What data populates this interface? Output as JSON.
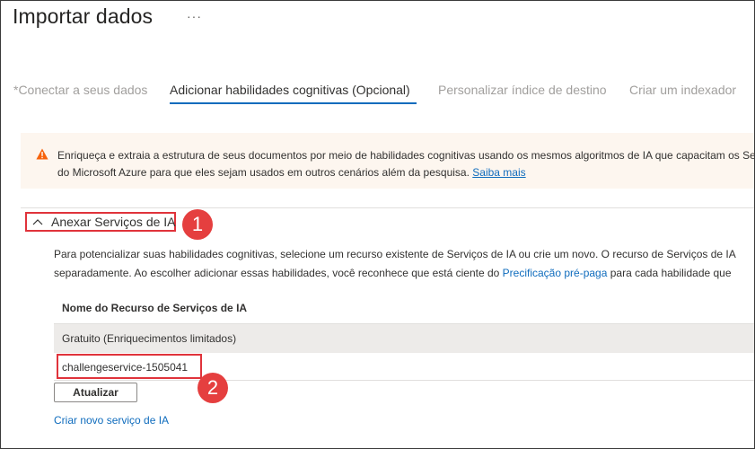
{
  "page": {
    "title": "Importar dados",
    "more_label": "···"
  },
  "tabs": [
    {
      "label": "*Conectar a seus dados",
      "state": "inactive"
    },
    {
      "label": "Adicionar habilidades cognitivas (Opcional)",
      "state": "active"
    },
    {
      "label": "Personalizar índice de destino",
      "state": "inactive"
    },
    {
      "label": "Criar um indexador",
      "state": "inactive"
    }
  ],
  "banner": {
    "icon": "warning-icon",
    "line1": "Enriqueça e extraia a estrutura de seus documentos por meio de habilidades cognitivas usando os mesmos algoritmos de IA que capacitam os Serviços",
    "line2": "do Microsoft Azure para que eles sejam usados em outros cenários além da pesquisa.",
    "link": "Saiba mais"
  },
  "section": {
    "title": "Anexar Serviços de IA",
    "expanded": true,
    "description_line1": "Para potencializar suas habilidades cognitivas, selecione um recurso existente de Serviços de IA ou crie um novo. O recurso de Serviços de IA",
    "description_line2_before": "separadamente. Ao escolher adicionar essas habilidades, você reconhece que está ciente do ",
    "description_link": "Precificação pré-paga",
    "description_line2_after": " para cada habilidade que"
  },
  "table": {
    "header": "Nome do Recurso de Serviços de IA",
    "rows": [
      {
        "name": "Gratuito (Enriquecimentos limitados)",
        "selected": true
      },
      {
        "name": "challengeservice-1505041",
        "selected": false
      }
    ]
  },
  "buttons": {
    "refresh": "Atualizar"
  },
  "links": {
    "create_new": "Criar novo serviço de IA"
  },
  "callouts": {
    "first": "1",
    "second": "2"
  },
  "colors": {
    "accent": "#0f6cbd",
    "callout": "#e53f3f",
    "warning": "#f7630c",
    "banner_bg": "#fdf6ef",
    "selected_row": "#edebe9"
  }
}
